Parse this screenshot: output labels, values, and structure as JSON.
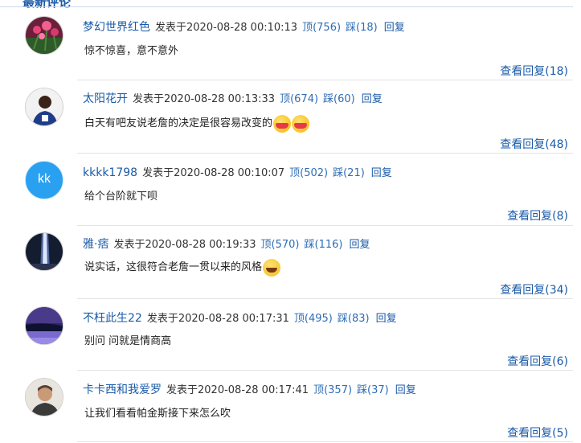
{
  "section": {
    "title_fragment": "最新评论"
  },
  "reply_label": "回复",
  "comments": [
    {
      "username": "梦幻世界红色",
      "posted": "发表于2020-08-28 00:10:13",
      "ding": "顶(756)",
      "cai": "踩(18)",
      "content": "惊不惊喜，意不意外",
      "view_replies": "查看回复(18)",
      "avatar": "avatar-flowers"
    },
    {
      "username": "太阳花开",
      "posted": "发表于2020-08-28 00:13:33",
      "ding": "顶(674)",
      "cai": "踩(60)",
      "content": "白天有吧友说老詹的决定是很容易改变的",
      "view_replies": "查看回复(48)",
      "avatar": "avatar-basketball-player",
      "emojis": [
        "blush-icon",
        "blush-icon"
      ]
    },
    {
      "username": "kkkk1798",
      "posted": "发表于2020-08-28 00:10:07",
      "ding": "顶(502)",
      "cai": "踩(21)",
      "content": "给个台阶就下呗",
      "view_replies": "查看回复(8)",
      "avatar": "avatar-kk-initials",
      "avatar_text": "kk"
    },
    {
      "username": "雅·痞",
      "posted": "发表于2020-08-28 00:19:33",
      "ding": "顶(570)",
      "cai": "踩(116)",
      "content": "说实话，这很符合老詹一贯以来的风格",
      "view_replies": "查看回复(34)",
      "avatar": "avatar-light-beam",
      "emojis": [
        "laugh-icon"
      ]
    },
    {
      "username": "不枉此生22",
      "posted": "发表于2020-08-28 00:17:31",
      "ding": "顶(495)",
      "cai": "踩(83)",
      "content": "别问 问就是情商高",
      "view_replies": "查看回复(6)",
      "avatar": "avatar-purple-lake"
    },
    {
      "username": "卡卡西和我爱罗",
      "posted": "发表于2020-08-28 00:17:41",
      "ding": "顶(357)",
      "cai": "踩(37)",
      "content": "让我们看看帕金斯接下来怎么吹",
      "view_replies": "查看回复(5)",
      "avatar": "avatar-man-portrait"
    }
  ],
  "colors": {
    "link": "#1a5aa8",
    "vote": "#2e6db4",
    "separator": "#e3e3e3",
    "kk_avatar": "#2aa0f0"
  }
}
